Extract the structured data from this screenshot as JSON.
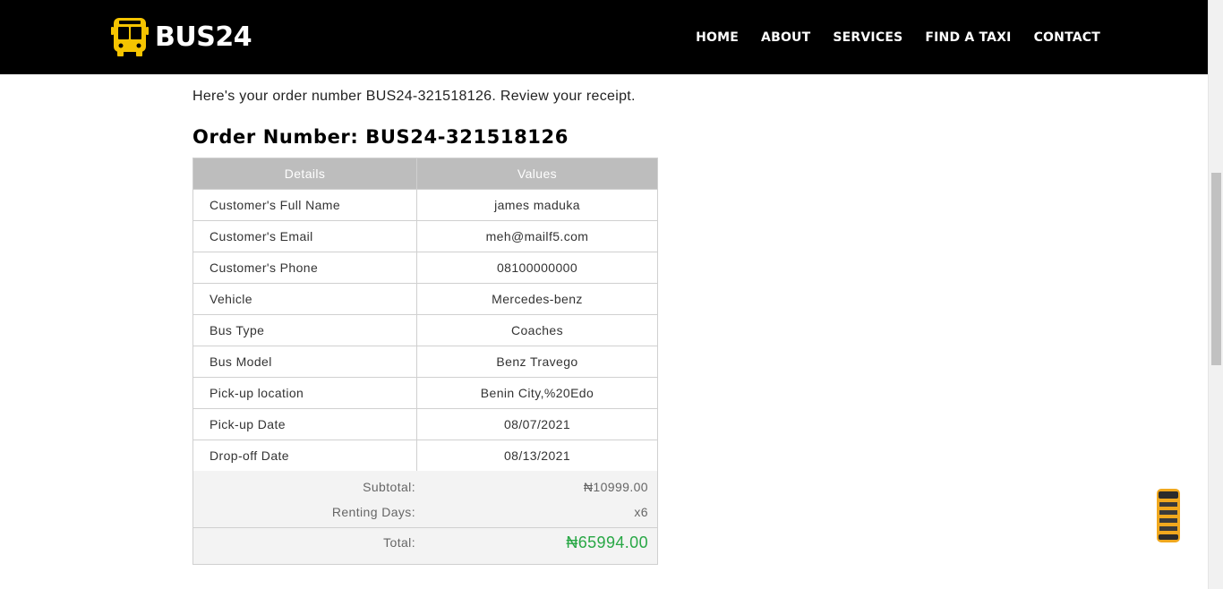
{
  "brand": {
    "name": "BUS24"
  },
  "nav": [
    "HOME",
    "ABOUT",
    "SERVICES",
    "FIND A TAXI",
    "CONTACT"
  ],
  "intro": "Here's your order number BUS24-321518126. Review your receipt.",
  "order_title": "Order Number: BUS24-321518126",
  "table": {
    "headers": [
      "Details",
      "Values"
    ],
    "rows": [
      [
        "Customer's Full Name",
        "james maduka"
      ],
      [
        "Customer's Email",
        "meh@mailf5.com"
      ],
      [
        "Customer's Phone",
        "08100000000"
      ],
      [
        "Vehicle",
        "Mercedes-benz"
      ],
      [
        "Bus Type",
        "Coaches"
      ],
      [
        "Bus Model",
        "Benz Travego"
      ],
      [
        "Pick-up location",
        "Benin City,%20Edo"
      ],
      [
        "Pick-up Date",
        "08/07/2021"
      ],
      [
        "Drop-off Date",
        "08/13/2021"
      ]
    ]
  },
  "summary": {
    "subtotal_label": "Subtotal:",
    "subtotal_value": "₦10999.00",
    "days_label": "Renting Days:",
    "days_value": "x6",
    "total_label": "Total:",
    "total_value": "₦65994.00"
  },
  "colors": {
    "header_bg": "#000000",
    "accent_yellow": "#f5c400",
    "total_green": "#28a745",
    "table_header_bg": "#bdbdbd"
  },
  "icons": {
    "logo": "bus-icon",
    "floating": "bus-top-view-icon"
  }
}
